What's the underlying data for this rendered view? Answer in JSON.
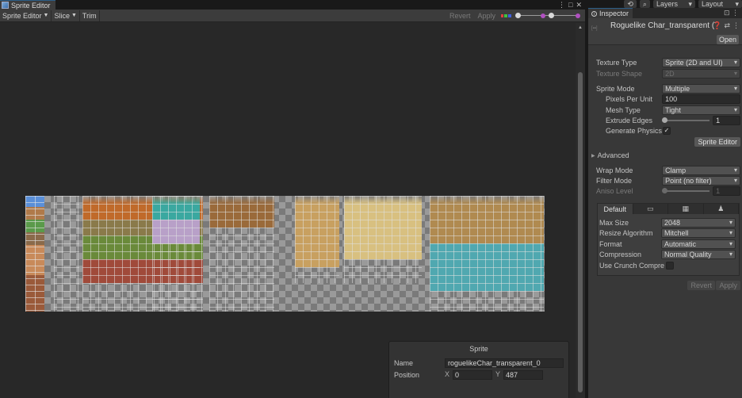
{
  "sprite_editor": {
    "tab_title": "Sprite Editor",
    "toolbar": {
      "mode_label": "Sprite Editor",
      "slice_label": "Slice",
      "trim_label": "Trim",
      "revert_label": "Revert",
      "apply_label": "Apply"
    },
    "sprite_panel": {
      "title": "Sprite",
      "name_label": "Name",
      "name_value": "roguelikeChar_transparent_0",
      "position_label": "Position",
      "x_label": "X",
      "x_value": "0",
      "y_label": "Y",
      "y_value": "487"
    }
  },
  "top_bar": {
    "layers_label": "Layers",
    "layout_label": "Layout"
  },
  "inspector": {
    "tab_label": "Inspector",
    "asset_title": "Roguelike Char_transparent (T",
    "open_label": "Open",
    "texture_type_label": "Texture Type",
    "texture_type_value": "Sprite (2D and UI)",
    "texture_shape_label": "Texture Shape",
    "texture_shape_value": "2D",
    "sprite_mode_label": "Sprite Mode",
    "sprite_mode_value": "Multiple",
    "ppu_label": "Pixels Per Unit",
    "ppu_value": "100",
    "mesh_type_label": "Mesh Type",
    "mesh_type_value": "Tight",
    "extrude_label": "Extrude Edges",
    "extrude_value": "1",
    "gen_physics_label": "Generate Physics",
    "sprite_editor_button": "Sprite Editor",
    "advanced_label": "Advanced",
    "wrap_mode_label": "Wrap Mode",
    "wrap_mode_value": "Clamp",
    "filter_mode_label": "Filter Mode",
    "filter_mode_value": "Point (no filter)",
    "aniso_label": "Aniso Level",
    "aniso_value": "1",
    "platform": {
      "default_tab": "Default",
      "max_size_label": "Max Size",
      "max_size_value": "2048",
      "resize_label": "Resize Algorithm",
      "resize_value": "Mitchell",
      "format_label": "Format",
      "format_value": "Automatic",
      "compression_label": "Compression",
      "compression_value": "Normal Quality",
      "crunch_label": "Use Crunch Compre"
    },
    "revert_label": "Revert",
    "apply_label": "Apply"
  }
}
